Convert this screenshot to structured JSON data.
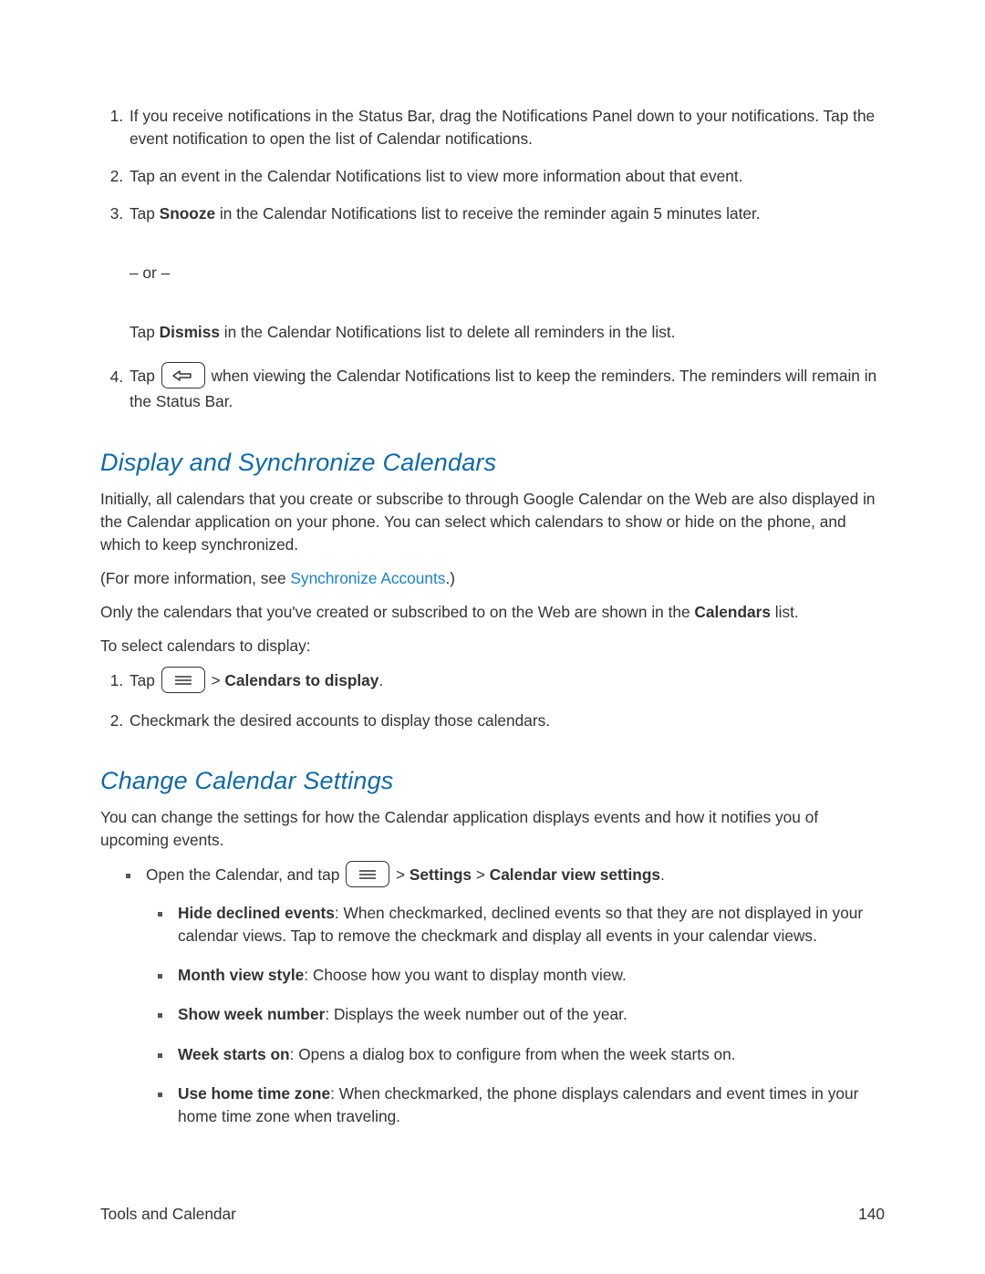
{
  "intro_list": {
    "1_a": "If you receive notifications in the Status Bar, drag the Notifications Panel down to your notifications. Tap the event notification to open the list of Calendar notifications.",
    "2_a": "Tap an event in the Calendar Notifications list to view more information about that event.",
    "3_a": "Tap ",
    "3_bold": "Snooze",
    "3_b": " in the Calendar Notifications list to receive the reminder again 5 minutes later.",
    "3_or": "– or –",
    "3_c": "Tap ",
    "3_bold2": "Dismiss",
    "3_d": " in the Calendar Notifications list to delete all reminders in the list.",
    "4_a": "Tap ",
    "4_b": " when viewing the Calendar Notifications list to keep the reminders. The reminders will remain in the Status Bar."
  },
  "section1": {
    "title": "Display and Synchronize Calendars",
    "p1": "Initially, all calendars that you create or subscribe to through Google Calendar on the Web are also displayed in the Calendar application on your phone. You can select which calendars to show or hide on the phone, and which to keep synchronized.",
    "p2_a": "(For more information, see ",
    "p2_link": "Synchronize Accounts",
    "p2_b": ".)",
    "p3_a": "Only the calendars that you've created or subscribed to on the Web are shown in the ",
    "p3_bold": "Calendars",
    "p3_b": " list.",
    "p4": "To select calendars to display:",
    "ol": {
      "1_a": "Tap ",
      "1_b": " > ",
      "1_bold": "Calendars to display",
      "1_c": ".",
      "2_a": "Checkmark the desired accounts to display those calendars."
    }
  },
  "section2": {
    "title": "Change Calendar Settings",
    "p1": "You can change the settings for how the Calendar application displays events and how it notifies you of upcoming events.",
    "top_bullet": {
      "a": "Open the Calendar, and tap ",
      "b": " > ",
      "bold1": "Settings",
      "c": " > ",
      "bold2": "Calendar view settings",
      "d": "."
    },
    "bullets": {
      "1_bold": "Hide declined events",
      "1_text": ": When checkmarked, declined events so that they are not displayed in your calendar views. Tap to remove the checkmark and display all events in your calendar views.",
      "2_bold": "Month view style",
      "2_text": ": Choose how you want to display month view.",
      "3_bold": "Show week number",
      "3_text": ": Displays the week number out of the year.",
      "4_bold": "Week starts on",
      "4_text": ": Opens a dialog box to configure from when the week starts on.",
      "5_bold": "Use home time zone",
      "5_text": ": When checkmarked, the phone displays calendars and event times in your home time zone when traveling."
    }
  },
  "footer": {
    "left": "Tools and Calendar",
    "right": "140"
  }
}
